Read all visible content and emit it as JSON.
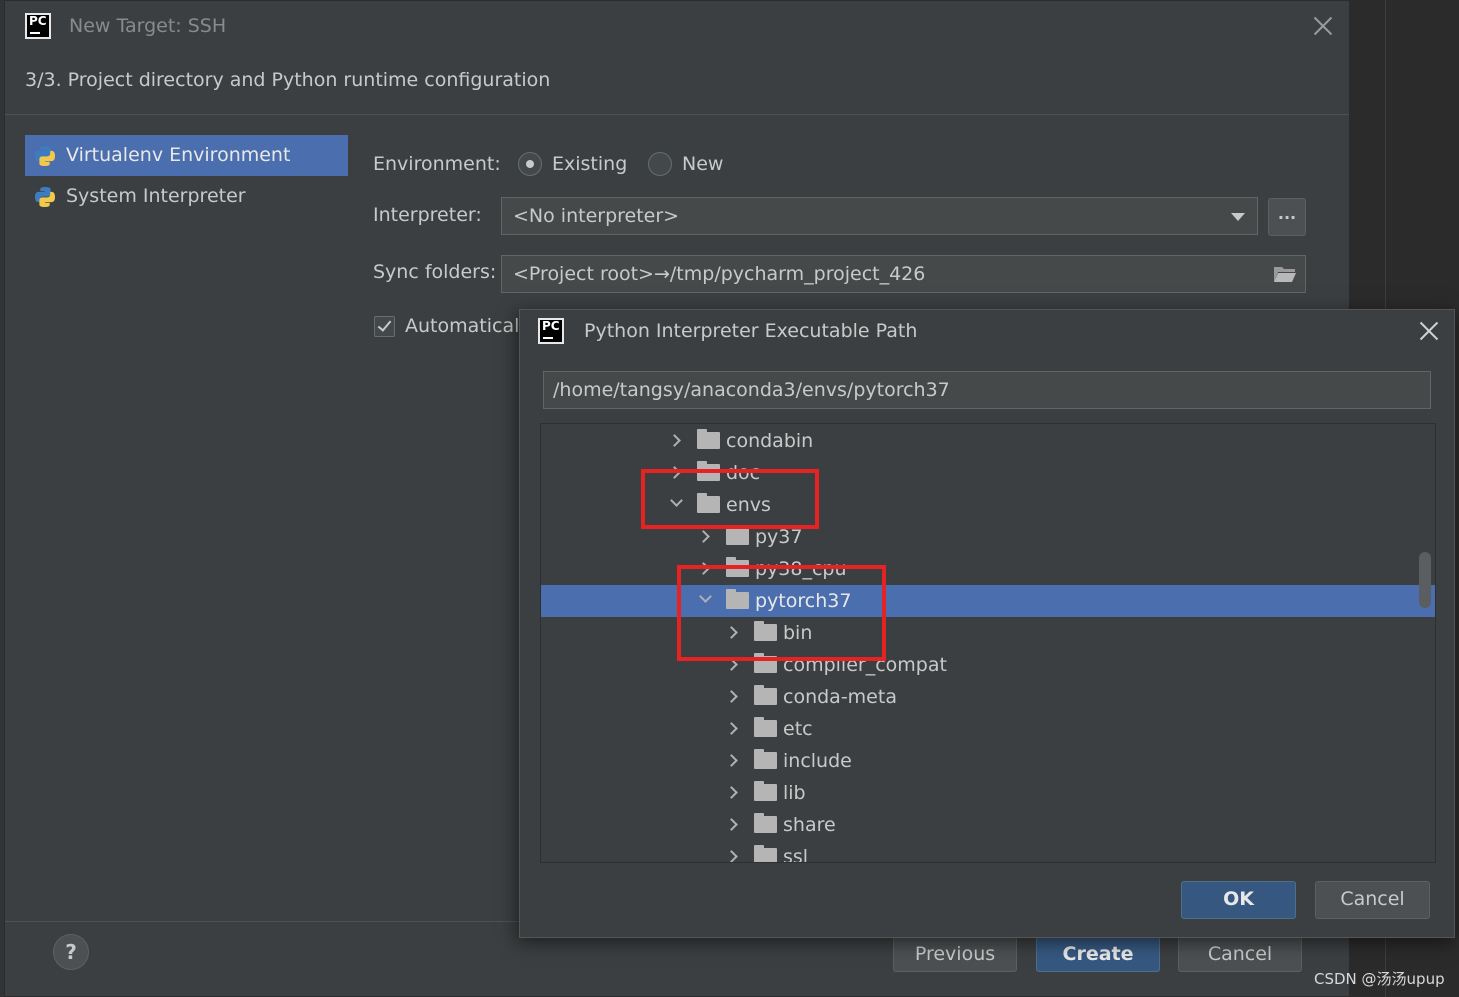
{
  "main_dialog": {
    "title": "New Target: SSH",
    "logo_text": "PC",
    "subtitle": "3/3. Project directory and Python runtime configuration",
    "env_list": [
      {
        "label": "Virtualenv Environment",
        "selected": true
      },
      {
        "label": "System Interpreter",
        "selected": false
      }
    ],
    "environment_label": "Environment:",
    "env_options": [
      {
        "label": "Existing",
        "checked": true
      },
      {
        "label": "New",
        "checked": false
      }
    ],
    "interpreter_label": "Interpreter:",
    "interpreter_value": "<No interpreter>",
    "browse_button": "...",
    "sync_label": "Sync folders:",
    "sync_value": "<Project root>→/tmp/pycharm_project_426",
    "auto_checkbox_label": "Automaticall",
    "help_label": "?",
    "buttons": {
      "previous": "Previous",
      "create": "Create",
      "cancel": "Cancel"
    }
  },
  "sub_dialog": {
    "title": "Python Interpreter Executable Path",
    "logo_text": "PC",
    "path_value": "/home/tangsy/anaconda3/envs/pytorch37",
    "tree": [
      {
        "label": "condabin",
        "expanded": false,
        "selected": false
      },
      {
        "label": "doc",
        "expanded": false,
        "selected": false
      },
      {
        "label": "envs",
        "expanded": true,
        "selected": false
      },
      {
        "label": "py37",
        "expanded": false,
        "selected": false
      },
      {
        "label": "py38_cpu",
        "expanded": false,
        "selected": false
      },
      {
        "label": "pytorch37",
        "expanded": true,
        "selected": true
      },
      {
        "label": "bin",
        "expanded": false,
        "selected": false
      },
      {
        "label": "compiler_compat",
        "expanded": false,
        "selected": false
      },
      {
        "label": "conda-meta",
        "expanded": false,
        "selected": false
      },
      {
        "label": "etc",
        "expanded": false,
        "selected": false
      },
      {
        "label": "include",
        "expanded": false,
        "selected": false
      },
      {
        "label": "lib",
        "expanded": false,
        "selected": false
      },
      {
        "label": "share",
        "expanded": false,
        "selected": false
      },
      {
        "label": "ssl",
        "expanded": false,
        "selected": false
      }
    ],
    "buttons": {
      "ok": "OK",
      "cancel": "Cancel"
    }
  },
  "watermark": "CSDN @汤汤upup",
  "colors": {
    "selection": "#4b6eaf",
    "highlight_box": "#e62222",
    "primary_button": "#365880"
  }
}
